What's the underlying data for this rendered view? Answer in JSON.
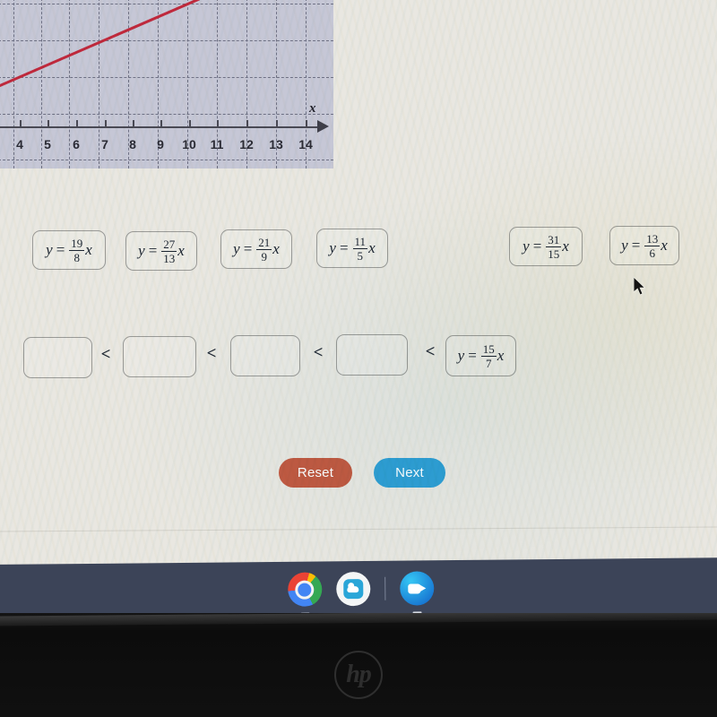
{
  "graph": {
    "x_axis_label": "x",
    "tick_labels": [
      "4",
      "5",
      "6",
      "7",
      "8",
      "9",
      "10",
      "11",
      "12",
      "13",
      "14"
    ],
    "line_color": "#c0293c",
    "plot_background": "#c6c7d6",
    "grid_color": "#6f7185"
  },
  "chart_data": {
    "type": "line",
    "title": "",
    "xlabel": "x",
    "ylabel": "",
    "xticks": [
      4,
      5,
      6,
      7,
      8,
      9,
      10,
      11,
      12,
      13,
      14
    ],
    "xlim": [
      3.5,
      14.5
    ],
    "grid": true,
    "series": [
      {
        "name": "red-line",
        "color": "#c0293c",
        "x": [
          3.5,
          8.5
        ],
        "y": [
          0,
          1
        ]
      }
    ]
  },
  "source_tiles": [
    {
      "name": "tile-19-8",
      "lhs": "y",
      "eq": "=",
      "num": "19",
      "den": "8",
      "var": "x"
    },
    {
      "name": "tile-27-13",
      "lhs": "y",
      "eq": "=",
      "num": "27",
      "den": "13",
      "var": "x"
    },
    {
      "name": "tile-21-9",
      "lhs": "y",
      "eq": "=",
      "num": "21",
      "den": "9",
      "var": "x"
    },
    {
      "name": "tile-11-5",
      "lhs": "y",
      "eq": "=",
      "num": "11",
      "den": "5",
      "var": "x"
    },
    {
      "name": "tile-31-15",
      "lhs": "y",
      "eq": "=",
      "num": "31",
      "den": "15",
      "var": "x"
    },
    {
      "name": "tile-13-6",
      "lhs": "y",
      "eq": "=",
      "num": "13",
      "den": "6",
      "var": "x"
    }
  ],
  "answer_row": {
    "slots": [
      {
        "name": "slot-1",
        "value": ""
      },
      {
        "name": "slot-2",
        "value": ""
      },
      {
        "name": "slot-3",
        "value": ""
      },
      {
        "name": "slot-4",
        "value": ""
      }
    ],
    "separator": "<",
    "filled_tile": {
      "lhs": "y",
      "eq": "=",
      "num": "15",
      "den": "7",
      "var": "x"
    }
  },
  "buttons": {
    "reset_label": "Reset",
    "reset_color": "#c25a42",
    "next_label": "Next",
    "next_color": "#2e9fd4"
  },
  "shelf": {
    "icons": [
      "chrome-icon",
      "files-cloud-icon",
      "zoom-icon"
    ]
  },
  "laptop": {
    "brand": "hp"
  }
}
